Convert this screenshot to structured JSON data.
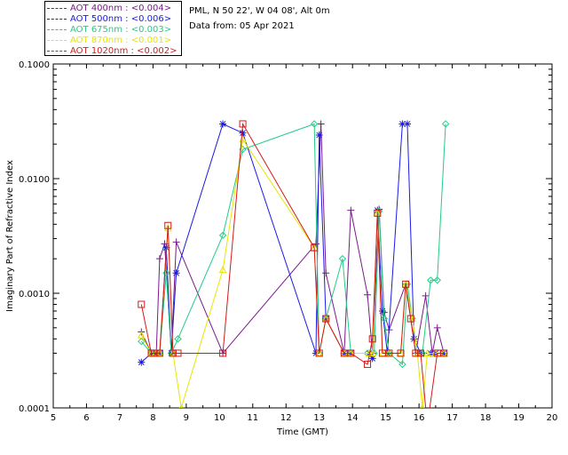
{
  "legend": [
    {
      "text": "AOT  400nm : <0.004>",
      "line_color": "#7a1a8a",
      "text_color": "#7a1a8a"
    },
    {
      "text": "AOT  500nm : <0.006>",
      "line_color": "#1a1ae6",
      "text_color": "#1a1ae6"
    },
    {
      "text": "AOT  675nm : <0.003>",
      "line_color": "#22cc88",
      "text_color": "#22cc88"
    },
    {
      "text": "AOT  870nm : <0.001>",
      "line_color": "#e6e600",
      "text_color": "#e6e600"
    },
    {
      "text": "AOT 1020nm : <0.002>",
      "line_color": "#d41a1a",
      "text_color": "#d41a1a"
    }
  ],
  "info": {
    "location": "PML, N 50 22', W 04 08', Alt 0m",
    "date": "Data from: 05 Apr 2021"
  },
  "chart_data": {
    "type": "scatter",
    "xlabel": "Time (GMT)",
    "ylabel": "Imaginary Part of Refractive Index",
    "xlim": [
      5,
      20
    ],
    "ylim": [
      0.0001,
      0.1
    ],
    "y_scale": "log",
    "x_ticks": [
      "5",
      "6",
      "7",
      "8",
      "9",
      "10",
      "11",
      "12",
      "13",
      "14",
      "15",
      "16",
      "17",
      "18",
      "19",
      "20"
    ],
    "y_ticks": [
      "0.0001",
      "0.0010",
      "0.0100",
      "0.1000"
    ],
    "y_tick_values": [
      0.0001,
      0.001,
      0.01,
      0.1
    ],
    "series": [
      {
        "name": "AOT  400nm",
        "color": "#7a1a8a",
        "marker": "plus",
        "points": [
          [
            7.65,
            0.00046
          ],
          [
            7.95,
            0.0003
          ],
          [
            8.1,
            0.0003
          ],
          [
            8.2,
            0.002
          ],
          [
            8.35,
            0.0027
          ],
          [
            8.55,
            0.0003
          ],
          [
            8.7,
            0.0028
          ],
          [
            10.1,
            0.0003
          ],
          [
            12.9,
            0.0027
          ],
          [
            13.05,
            0.03
          ],
          [
            13.2,
            0.0015
          ],
          [
            13.75,
            0.0003
          ],
          [
            13.95,
            0.0053
          ],
          [
            14.45,
            0.00097
          ],
          [
            14.6,
            0.0003
          ],
          [
            14.8,
            0.0054
          ],
          [
            14.95,
            0.00068
          ],
          [
            15.1,
            0.00048
          ],
          [
            15.6,
            0.0012
          ],
          [
            15.9,
            0.0003
          ],
          [
            16.2,
            0.00095
          ],
          [
            16.4,
            0.0003
          ],
          [
            16.55,
            0.0005
          ],
          [
            16.75,
            0.0003
          ]
        ]
      },
      {
        "name": "AOT  500nm",
        "color": "#1a1ae6",
        "marker": "star",
        "points": [
          [
            7.65,
            0.00025
          ],
          [
            7.95,
            0.0003
          ],
          [
            8.1,
            0.0003
          ],
          [
            8.2,
            0.0003
          ],
          [
            8.4,
            0.0025
          ],
          [
            8.55,
            0.0003
          ],
          [
            8.7,
            0.0015
          ],
          [
            10.1,
            0.03
          ],
          [
            10.7,
            0.025
          ],
          [
            12.9,
            0.0003
          ],
          [
            13.0,
            0.024
          ],
          [
            13.2,
            0.0006
          ],
          [
            13.75,
            0.0003
          ],
          [
            13.95,
            0.0003
          ],
          [
            14.5,
            0.0003
          ],
          [
            14.6,
            0.00027
          ],
          [
            14.75,
            0.0053
          ],
          [
            14.9,
            0.0007
          ],
          [
            15.05,
            0.0003
          ],
          [
            15.5,
            0.03
          ],
          [
            15.65,
            0.03
          ],
          [
            15.85,
            0.0004
          ],
          [
            16.05,
            0.0003
          ],
          [
            16.35,
            0.0003
          ],
          [
            16.5,
            0.0003
          ],
          [
            16.75,
            0.0003
          ]
        ]
      },
      {
        "name": "AOT  675nm",
        "color": "#22cc88",
        "marker": "diamond",
        "points": [
          [
            7.65,
            0.00038
          ],
          [
            7.95,
            0.0003
          ],
          [
            8.1,
            0.0003
          ],
          [
            8.2,
            0.0003
          ],
          [
            8.4,
            0.0015
          ],
          [
            8.55,
            0.0003
          ],
          [
            8.75,
            0.0004
          ],
          [
            10.1,
            0.0032
          ],
          [
            10.7,
            0.018
          ],
          [
            12.85,
            0.03
          ],
          [
            13.0,
            0.0003
          ],
          [
            13.2,
            0.0006
          ],
          [
            13.7,
            0.002
          ],
          [
            13.95,
            0.0003
          ],
          [
            14.45,
            0.0003
          ],
          [
            14.65,
            0.0003
          ],
          [
            14.8,
            0.0052
          ],
          [
            14.95,
            0.0006
          ],
          [
            15.1,
            0.0003
          ],
          [
            15.5,
            0.00024
          ],
          [
            15.65,
            0.0012
          ],
          [
            15.8,
            0.0006
          ],
          [
            15.95,
            0.0003
          ],
          [
            16.1,
            0.0003
          ],
          [
            16.35,
            0.0013
          ],
          [
            16.55,
            0.0013
          ],
          [
            16.8,
            0.03
          ]
        ]
      },
      {
        "name": "AOT  870nm",
        "color": "#e6e600",
        "marker": "triangle",
        "points": [
          [
            7.65,
            0.00043
          ],
          [
            7.95,
            0.0003
          ],
          [
            8.1,
            0.0003
          ],
          [
            8.2,
            0.0003
          ],
          [
            8.45,
            0.0037
          ],
          [
            8.6,
            0.0003
          ],
          [
            8.85,
            0.0001
          ],
          [
            10.1,
            0.0016
          ],
          [
            10.7,
            0.022
          ],
          [
            12.85,
            0.0025
          ],
          [
            13.0,
            0.0003
          ],
          [
            13.2,
            0.0006
          ],
          [
            13.75,
            0.0003
          ],
          [
            13.95,
            0.0003
          ],
          [
            14.5,
            0.0003
          ],
          [
            14.6,
            0.0003
          ],
          [
            14.75,
            0.005
          ],
          [
            14.9,
            0.0003
          ],
          [
            15.1,
            0.0003
          ],
          [
            15.45,
            0.0003
          ],
          [
            15.6,
            0.0012
          ],
          [
            15.8,
            0.0006
          ],
          [
            15.95,
            0.0003
          ],
          [
            16.1,
            0.0001
          ],
          [
            16.25,
            0.0003
          ],
          [
            16.5,
            0.0003
          ],
          [
            16.75,
            0.0003
          ]
        ]
      },
      {
        "name": "AOT 1020nm",
        "color": "#d41a1a",
        "marker": "square",
        "points": [
          [
            7.65,
            0.0008
          ],
          [
            7.95,
            0.0003
          ],
          [
            8.05,
            0.0003
          ],
          [
            8.2,
            0.0003
          ],
          [
            8.45,
            0.0039
          ],
          [
            8.6,
            0.0003
          ],
          [
            8.75,
            0.0003
          ],
          [
            10.1,
            0.0003
          ],
          [
            10.7,
            0.03
          ],
          [
            12.85,
            0.0025
          ],
          [
            13.0,
            0.0003
          ],
          [
            13.2,
            0.0006
          ],
          [
            13.75,
            0.0003
          ],
          [
            13.95,
            0.0003
          ],
          [
            14.45,
            0.00024
          ],
          [
            14.6,
            0.0004
          ],
          [
            14.75,
            0.005
          ],
          [
            14.9,
            0.0003
          ],
          [
            15.1,
            0.0003
          ],
          [
            15.45,
            0.0003
          ],
          [
            15.6,
            0.0012
          ],
          [
            15.75,
            0.0006
          ],
          [
            15.9,
            0.0003
          ],
          [
            16.05,
            0.0003
          ],
          [
            16.25,
            7e-05
          ],
          [
            16.55,
            0.0003
          ],
          [
            16.75,
            0.0003
          ]
        ]
      }
    ]
  }
}
